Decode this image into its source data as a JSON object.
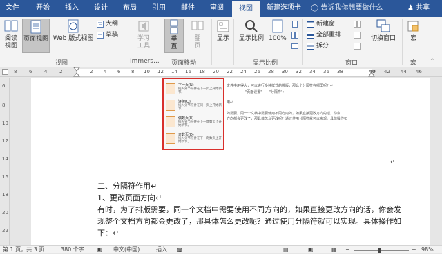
{
  "tabs": [
    "文件",
    "开始",
    "插入",
    "设计",
    "布局",
    "引用",
    "邮件",
    "审阅",
    "视图",
    "新建选项卡"
  ],
  "active_tab": "视图",
  "tell_me": "告诉我你想要做什么",
  "share": "共享",
  "ribbon": {
    "views": {
      "read_mode": "阅读视图",
      "print_layout": "页面视图",
      "web_layout": "Web 版式视图",
      "outline": "大纲",
      "draft": "草稿",
      "group_label": "视图"
    },
    "immersive": {
      "learning_tools": "学习工具",
      "group_label": "Immers..."
    },
    "page_movement": {
      "vertical": "垂直",
      "side_to_side": "翻页",
      "group_label": "页面移动"
    },
    "show": {
      "label": "显示"
    },
    "zoom": {
      "zoom": "显示比例",
      "hundred": "100%",
      "group_label": "显示比例"
    },
    "window": {
      "new_window": "新建窗口",
      "arrange_all": "全部重排",
      "split": "拆分",
      "switch_windows": "切换窗口",
      "group_label": "窗口"
    },
    "macros": {
      "label": "宏",
      "group_label": "宏"
    }
  },
  "ruler_numbers": [
    "8",
    "6",
    "4",
    "2",
    "",
    "2",
    "4",
    "6",
    "8",
    "10",
    "12",
    "14",
    "16",
    "18",
    "20",
    "22",
    "24",
    "26",
    "28",
    "30",
    "32",
    "34",
    "36",
    "38",
    "40",
    "42",
    "44",
    "46"
  ],
  "vruler_numbers": [
    "6",
    "8",
    "10",
    "12",
    "14",
    "16",
    "18",
    "20",
    "22"
  ],
  "inset": {
    "items": [
      {
        "title": "下一页(N)",
        "desc": "插入分节符并在下一页上开始新节。"
      },
      {
        "title": "连续(O)",
        "desc": "插入分节符并在同一页上开始新节。"
      },
      {
        "title": "偶数页(E)",
        "desc": "插入分节符并在下一偶数页上开始新节。"
      },
      {
        "title": "奇数页(D)",
        "desc": "插入分节符并在下一奇数页上开始新节。"
      }
    ]
  },
  "faint_text": {
    "line1": "文件中用得大，可以进行多种样式的排版，那么个分隔符在哪里呢？↵",
    "line2": "——\"页面设置\"——\"分隔符\"↵",
    "line3": "用↵",
    "line4": "的需要，同一个文档中需要使用不同方向的，如果直接更改方向的话，你会",
    "line5": "方向都会更改了，那具体怎么更改呢？通过使用分隔符就可以实现。具体操作如"
  },
  "document": {
    "heading": "二、分隔符作用↵",
    "sub": "1、更改页面方向↵",
    "para1": "有时，为了排版需要，同一个文档中需要使用不同方向的，如果直接更改方向的话，你会发",
    "para2": "现整个文档方向都会更改了，那具体怎么更改呢？通过使用分隔符就可以实现。具体操作如",
    "para3": "下：↵",
    "mark": "↵"
  },
  "status": {
    "page": "第 1 页，共 3 页",
    "words": "380 个字",
    "lang": "中文(中国)",
    "insert": "插入",
    "zoom": "98%"
  },
  "colors": {
    "accent": "#2b579a",
    "highlight_red": "#d9302c"
  }
}
